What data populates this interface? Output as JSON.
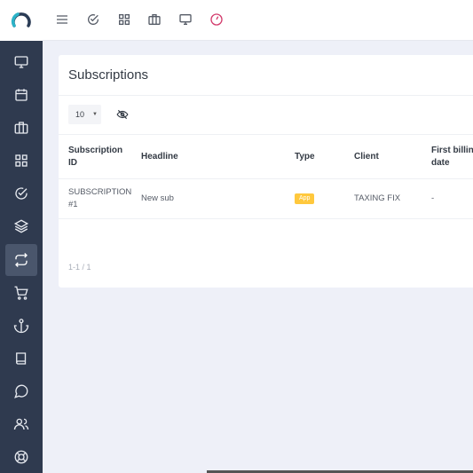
{
  "topbar": {
    "icons": [
      "menu-icon",
      "check-circle-icon",
      "grid-icon",
      "briefcase-icon",
      "monitor-icon",
      "gauge-icon"
    ],
    "accent_color": "#d23a6b"
  },
  "sidebar": {
    "items": [
      "monitor-icon",
      "calendar-icon",
      "briefcase-icon",
      "grid-icon",
      "check-circle-icon",
      "layers-icon",
      "repeat-icon",
      "cart-icon",
      "anchor-icon",
      "book-icon",
      "chat-icon",
      "users-icon",
      "lifebuoy-icon"
    ],
    "active_item": "repeat-icon",
    "bg_color": "#2f3a4f"
  },
  "card": {
    "title": "Subscriptions",
    "per_page": "10",
    "columns": {
      "id": [
        "Subscription",
        "ID"
      ],
      "headline": "Headline",
      "type": "Type",
      "client": "Client",
      "billing": [
        "First billing",
        "date"
      ]
    },
    "rows": [
      {
        "id": [
          "SUBSCRIPTION",
          "#1"
        ],
        "headline": "New sub",
        "type": "App",
        "client": "TAXING FIX",
        "billing": "-"
      }
    ],
    "pagination": "1-1 / 1"
  }
}
